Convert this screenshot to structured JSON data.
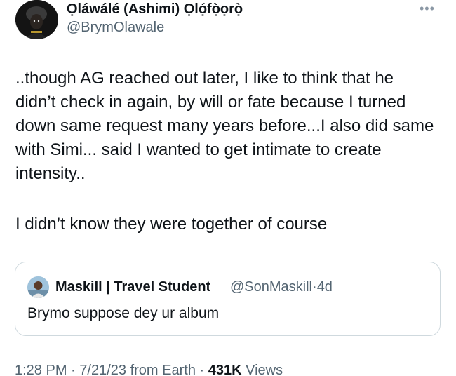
{
  "author": {
    "display_name": "Ọláwálé (Ashimi) Ọlọ́fọ̀ọrọ̀",
    "handle": "@BrymOlawale"
  },
  "more_icon": "more-horizontal-icon",
  "tweet": {
    "paragraph_1": "..though AG reached out later, I like to think that he didn’t check in again, by will or fate because I turned down same request many years before...I also did same with Simi... said I wanted to get intimate to create intensity..",
    "paragraph_2": "I didn’t know they were together of course"
  },
  "quoted": {
    "display_name": "Maskill | Travel Student",
    "handle": "@SonMaskill",
    "separator": "·",
    "age": "4d",
    "text": "Brymo suppose dey ur album"
  },
  "footer": {
    "time": "1:28 PM",
    "sep1": "·",
    "date": "7/21/23",
    "source": "from Earth",
    "sep2": "·",
    "views_count": "431K",
    "views_label": "Views"
  }
}
